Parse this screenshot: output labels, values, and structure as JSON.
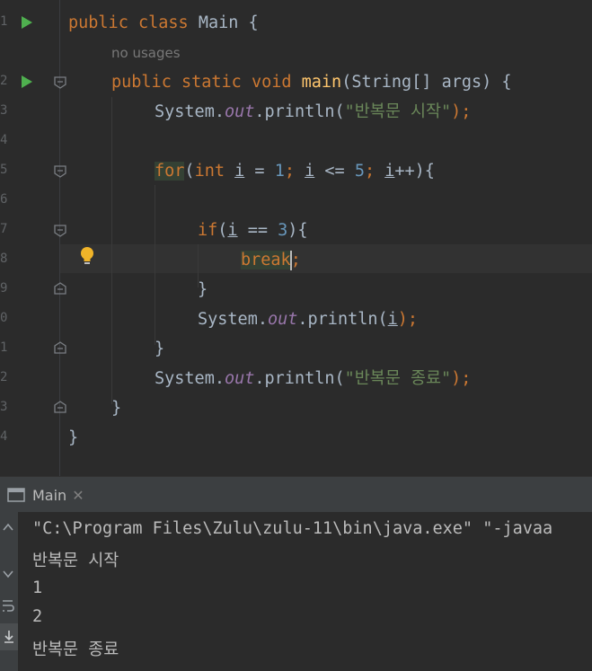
{
  "editor": {
    "line_numbers": [
      "1",
      "2",
      "3",
      "4",
      "5",
      "6",
      "7",
      "8",
      "9",
      "0",
      "1",
      "2",
      "3",
      "4"
    ],
    "hint_text": "no usages",
    "code": {
      "l1": {
        "kw1": "public",
        "kw2": "class",
        "name": "Main",
        "brace": " {"
      },
      "l2": {
        "kw1": "public",
        "kw2": "static",
        "kw3": "void",
        "fn": "main",
        "params": "(String[] args) {"
      },
      "l3": {
        "obj": "System.",
        "fld": "out",
        "call": ".println(",
        "str": "\"반복문 시작\"",
        "end": ");"
      },
      "l5": {
        "kw": "for",
        "p1": "(",
        "kw2": "int",
        "sp": " ",
        "v1": "i",
        "eq": " = ",
        "n1": "1",
        "sc1": "; ",
        "v2": "i",
        "le": " <= ",
        "n2": "5",
        "sc2": "; ",
        "v3": "i",
        "inc": "++){"
      },
      "l7": {
        "kw": "if",
        "p1": "(",
        "v": "i",
        "eq": " == ",
        "n": "3",
        "end": "){"
      },
      "l8": {
        "kw": "break",
        "end": ";"
      },
      "l9": {
        "brace": "}"
      },
      "l10": {
        "obj": "System.",
        "fld": "out",
        "call": ".println(",
        "v": "i",
        "end": ");"
      },
      "l11": {
        "brace": "}"
      },
      "l12": {
        "obj": "System.",
        "fld": "out",
        "call": ".println(",
        "str": "\"반복문 종료\"",
        "end": ");"
      },
      "l13": {
        "brace": "}"
      },
      "l14": {
        "brace": "}"
      }
    }
  },
  "panel": {
    "tab_label": "Main",
    "tab_close": "✕"
  },
  "console": {
    "lines": [
      "\"C:\\Program Files\\Zulu\\zulu-11\\bin\\java.exe\" \"-javaa",
      "반복문 시작",
      "1",
      "2",
      "반복문 종료"
    ]
  },
  "colors": {
    "keyword": "#cc7832",
    "function": "#ffc66d",
    "number": "#6897bb",
    "string": "#6a8759",
    "field": "#9876aa",
    "run": "#4fb04f"
  }
}
